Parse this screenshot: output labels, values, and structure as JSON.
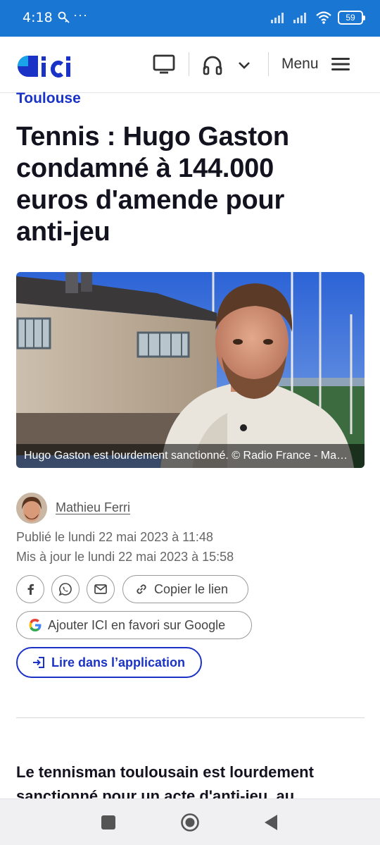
{
  "status_bar": {
    "time": "4:18",
    "dots": "···",
    "battery": "59"
  },
  "header": {
    "logo_text": "ici",
    "menu_label": "Menu"
  },
  "article": {
    "kicker": "Toulouse",
    "title": "Tennis : Hugo Gaston condamné à 144.000 euros d'amende pour anti-jeu",
    "photo_caption": "Hugo Gaston est lourdement sanctionné. © Radio France - Mathieu Ferri",
    "author": "Mathieu Ferri",
    "published": "Publié le lundi 22 mai 2023 à 11:48",
    "updated": "Mis à jour le lundi 22 mai 2023 à 15:58",
    "lead": "Le tennisman toulousain est lourdement sanctionné pour un acte d'anti-jeu, au"
  },
  "share": {
    "copy_label": "Copier le lien",
    "google_label": "Ajouter ICI en favori sur Google",
    "app_label": "Lire dans l’application"
  },
  "icons": {
    "status": [
      "key-icon",
      "signal-icon",
      "wifi-icon",
      "battery-icon"
    ],
    "header": [
      "tv-icon",
      "headphones-icon",
      "chevron-down-icon",
      "hamburger-icon"
    ],
    "share": [
      "facebook-icon",
      "whatsapp-icon",
      "mail-icon",
      "link-icon",
      "google-icon",
      "open-app-icon"
    ],
    "nav": [
      "recents-icon",
      "home-icon",
      "back-icon"
    ]
  },
  "colors": {
    "status_bar": "#1976d2",
    "brand_blue": "#1a33c6",
    "logo_accent": "#1aa3e8",
    "text_dark": "#13121f"
  }
}
